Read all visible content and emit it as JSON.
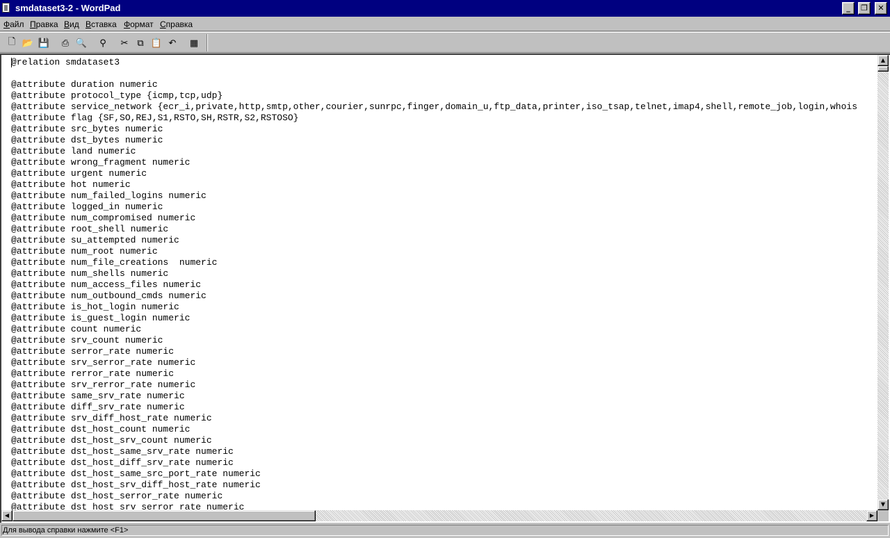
{
  "window": {
    "title": "smdataset3-2 - WordPad",
    "minimize_glyph": "_",
    "restore_glyph": "❐",
    "close_glyph": "✕"
  },
  "menu": {
    "items": [
      {
        "key": "Ф",
        "rest": "айл"
      },
      {
        "key": "П",
        "rest": "равка"
      },
      {
        "key": "В",
        "rest": "ид"
      },
      {
        "key": "В",
        "rest": "ставка"
      },
      {
        "key": "Ф",
        "rest": "ормат"
      },
      {
        "key": "С",
        "rest": "правка"
      }
    ]
  },
  "toolbar": {
    "buttons": [
      {
        "icon": "new-document-icon",
        "glyph": "🗋"
      },
      {
        "icon": "open-folder-icon",
        "glyph": "📂"
      },
      {
        "icon": "save-disk-icon",
        "glyph": "💾"
      },
      {
        "icon": "print-icon",
        "glyph": "⎙"
      },
      {
        "icon": "print-preview-icon",
        "glyph": "🔍"
      },
      {
        "icon": "find-binoculars-icon",
        "glyph": "⚲"
      },
      {
        "icon": "cut-scissors-icon",
        "glyph": "✂"
      },
      {
        "icon": "copy-icon",
        "glyph": "⧉"
      },
      {
        "icon": "paste-icon",
        "glyph": "📋"
      },
      {
        "icon": "undo-icon",
        "glyph": "↶"
      },
      {
        "icon": "insert-datetime-icon",
        "glyph": "▦"
      }
    ]
  },
  "document": {
    "lines": [
      "@relation smdataset3",
      "",
      "@attribute duration numeric",
      "@attribute protocol_type {icmp,tcp,udp}",
      "@attribute service_network {ecr_i,private,http,smtp,other,courier,sunrpc,finger,domain_u,ftp_data,printer,iso_tsap,telnet,imap4,shell,remote_job,login,whois",
      "@attribute flag {SF,SO,REJ,S1,RSTO,SH,RSTR,S2,RSTOSO}",
      "@attribute src_bytes numeric",
      "@attribute dst_bytes numeric",
      "@attribute land numeric",
      "@attribute wrong_fragment numeric",
      "@attribute urgent numeric",
      "@attribute hot numeric",
      "@attribute num_failed_logins numeric",
      "@attribute logged_in numeric",
      "@attribute num_compromised numeric",
      "@attribute root_shell numeric",
      "@attribute su_attempted numeric",
      "@attribute num_root numeric",
      "@attribute num_file_creations  numeric",
      "@attribute num_shells numeric",
      "@attribute num_access_files numeric",
      "@attribute num_outbound_cmds numeric",
      "@attribute is_hot_login numeric",
      "@attribute is_guest_login numeric",
      "@attribute count numeric",
      "@attribute srv_count numeric",
      "@attribute serror_rate numeric",
      "@attribute srv_serror_rate numeric",
      "@attribute rerror_rate numeric",
      "@attribute srv_rerror_rate numeric",
      "@attribute same_srv_rate numeric",
      "@attribute diff_srv_rate numeric",
      "@attribute srv_diff_host_rate numeric",
      "@attribute dst_host_count numeric",
      "@attribute dst_host_srv_count numeric",
      "@attribute dst_host_same_srv_rate numeric",
      "@attribute dst_host_diff_srv_rate numeric",
      "@attribute dst_host_same_src_port_rate numeric",
      "@attribute dst_host_srv_diff_host_rate numeric",
      "@attribute dst_host_serror_rate numeric",
      "@attribute dst_host_srv_serror_rate numeric"
    ]
  },
  "scrollbars": {
    "up_glyph": "▲",
    "down_glyph": "▼",
    "left_glyph": "◀",
    "right_glyph": "▶"
  },
  "statusbar": {
    "text": "Для вывода справки нажмите <F1>"
  }
}
